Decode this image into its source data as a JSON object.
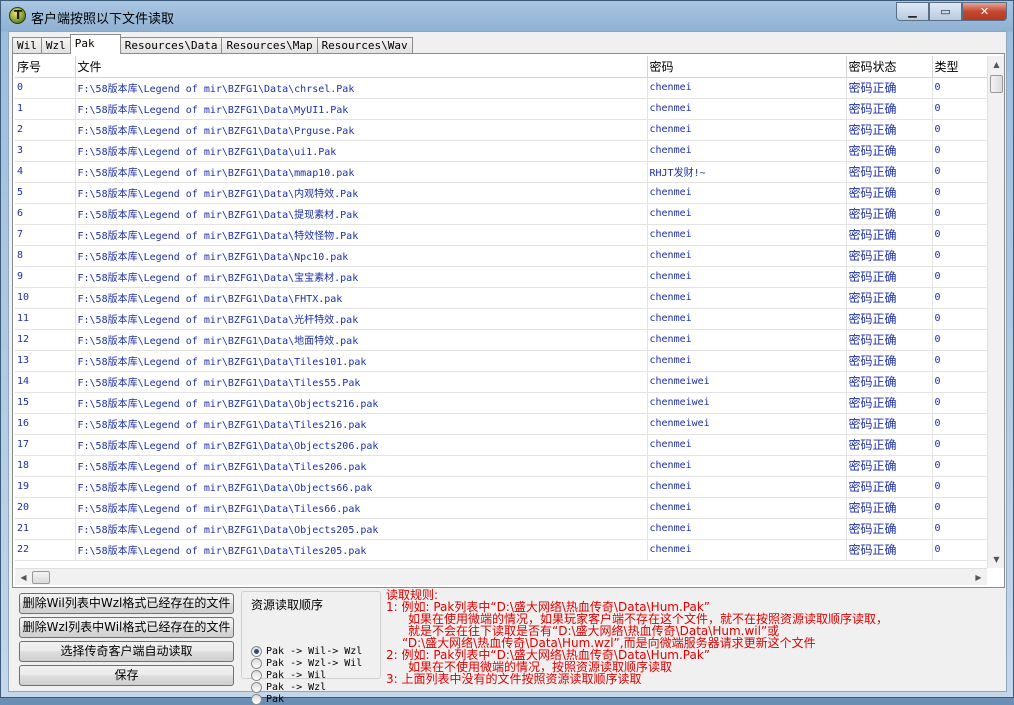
{
  "window": {
    "title": "客户端按照以下文件读取"
  },
  "tabs": [
    "Wil",
    "Wzl",
    "Pak",
    "Resources\\Data",
    "Resources\\Map",
    "Resources\\Wav"
  ],
  "active_tab": 2,
  "table": {
    "columns": [
      "序号",
      "文件",
      "密码",
      "密码状态",
      "类型"
    ],
    "rows": [
      [
        "0",
        "F:\\58版本库\\Legend of mir\\BZFG1\\Data\\chrsel.Pak",
        "chenmei",
        "密码正确",
        "0"
      ],
      [
        "1",
        "F:\\58版本库\\Legend of mir\\BZFG1\\Data\\MyUI1.Pak",
        "chenmei",
        "密码正确",
        "0"
      ],
      [
        "2",
        "F:\\58版本库\\Legend of mir\\BZFG1\\Data\\Prguse.Pak",
        "chenmei",
        "密码正确",
        "0"
      ],
      [
        "3",
        "F:\\58版本库\\Legend of mir\\BZFG1\\Data\\ui1.Pak",
        "chenmei",
        "密码正确",
        "0"
      ],
      [
        "4",
        "F:\\58版本库\\Legend of mir\\BZFG1\\Data\\mmap10.pak",
        "RHJT发财!~",
        "密码正确",
        "0"
      ],
      [
        "5",
        "F:\\58版本库\\Legend of mir\\BZFG1\\Data\\内观特效.Pak",
        "chenmei",
        "密码正确",
        "0"
      ],
      [
        "6",
        "F:\\58版本库\\Legend of mir\\BZFG1\\Data\\提现素材.Pak",
        "chenmei",
        "密码正确",
        "0"
      ],
      [
        "7",
        "F:\\58版本库\\Legend of mir\\BZFG1\\Data\\特效怪物.Pak",
        "chenmei",
        "密码正确",
        "0"
      ],
      [
        "8",
        "F:\\58版本库\\Legend of mir\\BZFG1\\Data\\Npc10.pak",
        "chenmei",
        "密码正确",
        "0"
      ],
      [
        "9",
        "F:\\58版本库\\Legend of mir\\BZFG1\\Data\\宝宝素材.pak",
        "chenmei",
        "密码正确",
        "0"
      ],
      [
        "10",
        "F:\\58版本库\\Legend of mir\\BZFG1\\Data\\FHTX.pak",
        "chenmei",
        "密码正确",
        "0"
      ],
      [
        "11",
        "F:\\58版本库\\Legend of mir\\BZFG1\\Data\\光杆特效.pak",
        "chenmei",
        "密码正确",
        "0"
      ],
      [
        "12",
        "F:\\58版本库\\Legend of mir\\BZFG1\\Data\\地面特效.pak",
        "chenmei",
        "密码正确",
        "0"
      ],
      [
        "13",
        "F:\\58版本库\\Legend of mir\\BZFG1\\Data\\Tiles101.pak",
        "chenmei",
        "密码正确",
        "0"
      ],
      [
        "14",
        "F:\\58版本库\\Legend of mir\\BZFG1\\Data\\Tiles55.Pak",
        "chenmeiwei",
        "密码正确",
        "0"
      ],
      [
        "15",
        "F:\\58版本库\\Legend of mir\\BZFG1\\Data\\Objects216.pak",
        "chenmeiwei",
        "密码正确",
        "0"
      ],
      [
        "16",
        "F:\\58版本库\\Legend of mir\\BZFG1\\Data\\Tiles216.pak",
        "chenmeiwei",
        "密码正确",
        "0"
      ],
      [
        "17",
        "F:\\58版本库\\Legend of mir\\BZFG1\\Data\\Objects206.pak",
        "chenmei",
        "密码正确",
        "0"
      ],
      [
        "18",
        "F:\\58版本库\\Legend of mir\\BZFG1\\Data\\Tiles206.pak",
        "chenmei",
        "密码正确",
        "0"
      ],
      [
        "19",
        "F:\\58版本库\\Legend of mir\\BZFG1\\Data\\Objects66.pak",
        "chenmei",
        "密码正确",
        "0"
      ],
      [
        "20",
        "F:\\58版本库\\Legend of mir\\BZFG1\\Data\\Tiles66.pak",
        "chenmei",
        "密码正确",
        "0"
      ],
      [
        "21",
        "F:\\58版本库\\Legend of mir\\BZFG1\\Data\\Objects205.pak",
        "chenmei",
        "密码正确",
        "0"
      ],
      [
        "22",
        "F:\\58版本库\\Legend of mir\\BZFG1\\Data\\Tiles205.pak",
        "chenmei",
        "密码正确",
        "0"
      ]
    ]
  },
  "buttons": {
    "delete_wil": "删除Wil列表中Wzl格式已经存在的文件",
    "delete_wzl": "删除Wzl列表中Wil格式已经存在的文件",
    "select_client": "选择传奇客户端自动读取",
    "save": "保存"
  },
  "order_group": {
    "title": "资源读取顺序",
    "options": [
      "Pak -> Wil-> Wzl",
      "Pak -> Wzl-> Wil",
      "Pak -> Wil",
      "Pak -> Wzl",
      "Pak"
    ],
    "selected": 0
  },
  "rules": {
    "heading": "读取规则:",
    "lines": [
      "1: 例如: Pak列表中“D:\\盛大网络\\热血传奇\\Data\\Hum.Pak”",
      "如果在使用微端的情况，如果玩家客户端不存在这个文件，就不在按照资源读取顺序读取，",
      "就是不会在往下读取是否有“D:\\盛大网络\\热血传奇\\Data\\Hum.wil”或",
      "“D:\\盛大网络\\热血传奇\\Data\\Hum.wzl”,而是向微端服务器请求更新这个文件",
      "2: 例如: Pak列表中“D:\\盛大网络\\热血传奇\\Data\\Hum.Pak”",
      "如果在不使用微端的情况，按照资源读取顺序读取",
      "3: 上面列表中没有的文件按照资源读取顺序读取"
    ]
  }
}
